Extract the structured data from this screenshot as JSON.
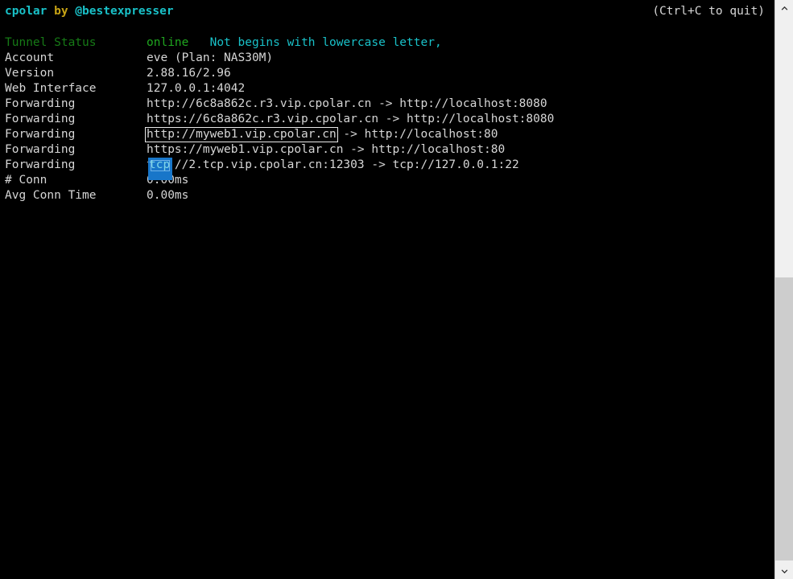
{
  "header": {
    "brand": "cpolar",
    "by": "by",
    "handle": "@bestexpresser",
    "quit_hint": "(Ctrl+C to quit)"
  },
  "status_rows": [
    {
      "label": "Tunnel Status",
      "value": "online",
      "note": "Not begins with lowercase letter,",
      "label_color": "#167a16",
      "value_color": "#1fa61f",
      "note_color": "#19c1c8"
    },
    {
      "label": "Account",
      "value": "eve (Plan: NAS30M)"
    },
    {
      "label": "Version",
      "value": "2.88.16/2.96"
    },
    {
      "label": "Web Interface",
      "value": "127.0.0.1:4042"
    },
    {
      "label": "Forwarding",
      "value": "http://6c8a862c.r3.vip.cpolar.cn -> http://localhost:8080"
    },
    {
      "label": "Forwarding",
      "value": "https://6c8a862c.r3.vip.cpolar.cn -> http://localhost:8080"
    },
    {
      "label": "Forwarding",
      "link": "http://myweb1.vip.cpolar.cn",
      "link_focused": true,
      "value_rest": " -> http://localhost:80"
    },
    {
      "label": "Forwarding",
      "value": "https://myweb1.vip.cpolar.cn -> http://localhost:80"
    },
    {
      "label": "Forwarding",
      "value": "tcp://2.tcp.vip.cpolar.cn:12303 -> tcp://127.0.0.1:22",
      "selection": "tcp"
    },
    {
      "label": "# Conn",
      "value": "0.00ms"
    },
    {
      "label": "Avg Conn Time",
      "value": "0.00ms"
    }
  ],
  "selection": {
    "text": "tcp",
    "background": "#1876c9",
    "text_color": "#7fd6e8"
  },
  "scrollbar": {
    "up_arrow": "chevron-up",
    "down_arrow": "chevron-down",
    "thumb_color": "#cdcdcd",
    "track_color": "#f0f0f0"
  },
  "colors": {
    "background": "#000000",
    "foreground": "#d6d6d6",
    "cyan": "#19c1c8",
    "yellow": "#c8a415",
    "green": "#1fa61f",
    "dark_green": "#167a16"
  }
}
